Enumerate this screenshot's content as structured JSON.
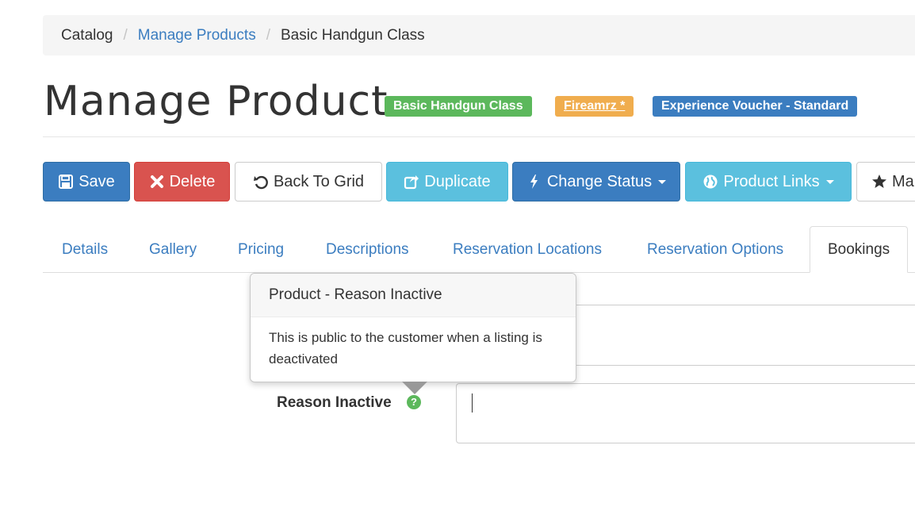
{
  "breadcrumb": {
    "items": [
      "Catalog",
      "Manage Products",
      "Basic Handgun Class"
    ],
    "separator": "/"
  },
  "page": {
    "title": "Manage Product",
    "badges": [
      "Basic Handgun Class",
      "Fireamrz *",
      "Experience Voucher - Standard"
    ]
  },
  "toolbar": {
    "save": "Save",
    "delete": "Delete",
    "back": "Back To Grid",
    "duplicate": "Duplicate",
    "change_status": "Change Status",
    "product_links": "Product Links",
    "more": "Ma"
  },
  "tabs": [
    "Details",
    "Gallery",
    "Pricing",
    "Descriptions",
    "Reservation Locations",
    "Reservation Options",
    "Bookings"
  ],
  "form": {
    "reason_inactive_label": "Reason Inactive",
    "help": "?"
  },
  "popover": {
    "title": "Product - Reason Inactive",
    "content": "This is public to the customer when a listing is deactivated"
  },
  "colors": {
    "primary": "#3b7dc0",
    "success": "#5cb85c",
    "warning": "#f0ad4e",
    "danger": "#d9534f",
    "info": "#5bc0de"
  }
}
